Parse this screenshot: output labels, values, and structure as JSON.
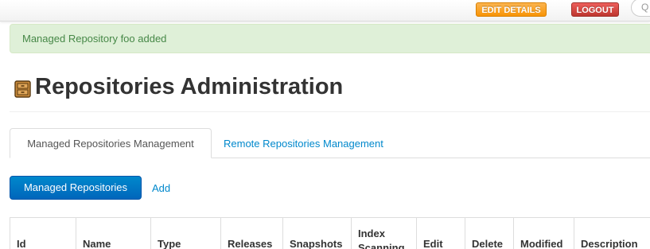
{
  "topbar": {
    "edit_details_label": "EDIT DETAILS",
    "logout_label": "LOGOUT",
    "search_glyph": "Q",
    "edit_color": "#f89406",
    "logout_color": "#bd362f"
  },
  "alert": {
    "message": "Managed Repository foo added",
    "color": "#468847",
    "background": "#dff0d8"
  },
  "page": {
    "title": "Repositories Administration",
    "icon": "repository-cabinet-icon"
  },
  "tabs": [
    {
      "label": "Managed Repositories Management",
      "active": true
    },
    {
      "label": "Remote Repositories Management",
      "active": false
    }
  ],
  "actions": {
    "managed_repositories_label": "Managed Repositories",
    "add_label": "Add"
  },
  "table": {
    "headers": [
      "Id",
      "Name",
      "Type",
      "Releases",
      "Snapshots",
      "Index Scanning",
      "Edit",
      "Delete",
      "Modified",
      "Description"
    ]
  },
  "colors": {
    "link": "#0088cc",
    "primary_button": "#0088cc"
  }
}
